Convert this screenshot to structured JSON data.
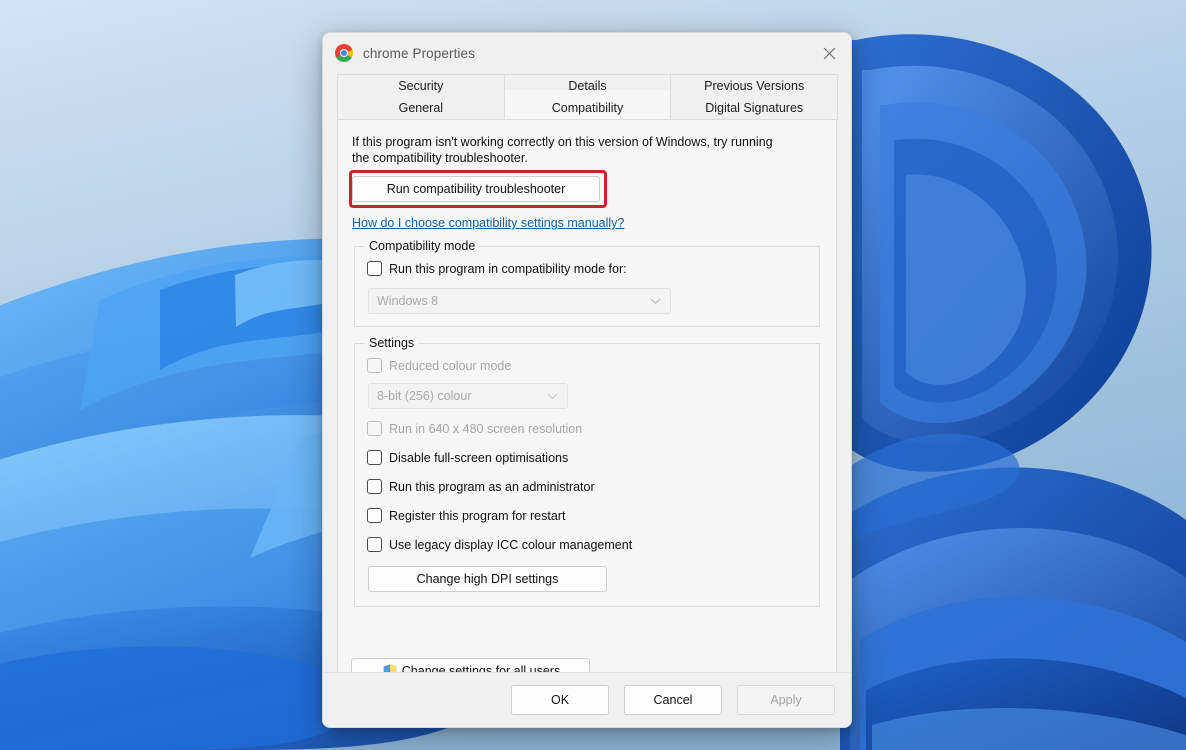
{
  "window": {
    "title": "chrome Properties",
    "app_icon": "chrome-icon",
    "close_icon": "close-icon"
  },
  "tabs": {
    "row1": [
      {
        "label": "Security",
        "active": false
      },
      {
        "label": "Details",
        "active": false
      },
      {
        "label": "Previous Versions",
        "active": false
      }
    ],
    "row2": [
      {
        "label": "General",
        "active": false
      },
      {
        "label": "Compatibility",
        "active": true
      },
      {
        "label": "Digital Signatures",
        "active": false
      }
    ]
  },
  "compatibility_tab": {
    "intro_text": "If this program isn't working correctly on this version of Windows, try running the compatibility troubleshooter.",
    "troubleshooter_button": "Run compatibility troubleshooter",
    "highlight_color": "#cf2128",
    "help_link": "How do I choose compatibility settings manually?",
    "compatibility_mode": {
      "legend": "Compatibility mode",
      "checkbox_label": "Run this program in compatibility mode for:",
      "checkbox_checked": false,
      "checkbox_disabled": false,
      "select_value": "Windows 8",
      "select_disabled": true,
      "chevron_icon": "chevron-down-icon"
    },
    "settings": {
      "legend": "Settings",
      "items": [
        {
          "label": "Reduced colour mode",
          "checked": false,
          "disabled": true
        },
        {
          "label": "Run in 640 x 480 screen resolution",
          "checked": false,
          "disabled": true
        },
        {
          "label": "Disable full-screen optimisations",
          "checked": false,
          "disabled": false
        },
        {
          "label": "Run this program as an administrator",
          "checked": false,
          "disabled": false
        },
        {
          "label": "Register this program for restart",
          "checked": false,
          "disabled": false
        },
        {
          "label": "Use legacy display ICC colour management",
          "checked": false,
          "disabled": false
        }
      ],
      "colour_depth_value": "8-bit (256) colour",
      "colour_depth_disabled": true,
      "chevron_icon": "chevron-down-icon",
      "dpi_button": "Change high DPI settings"
    },
    "all_users_button": {
      "label": "Change settings for all users",
      "icon": "uac-shield-icon"
    }
  },
  "footer": {
    "ok": "OK",
    "cancel": "Cancel",
    "apply": "Apply",
    "apply_disabled": true
  }
}
